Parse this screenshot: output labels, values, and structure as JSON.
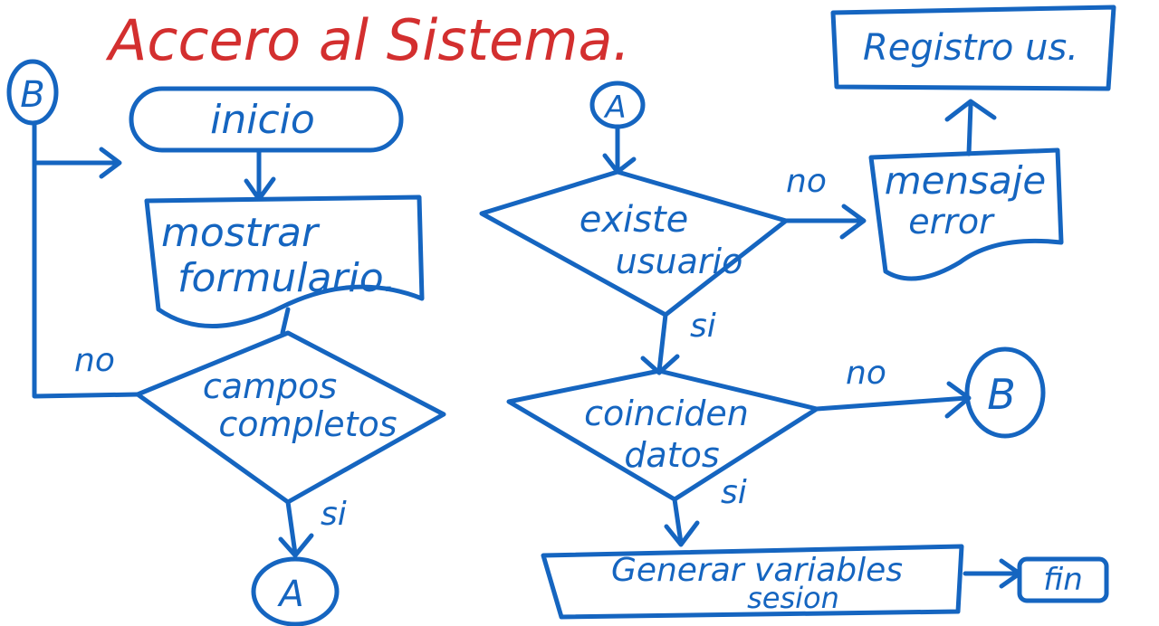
{
  "title": "Accero al Sistema.",
  "nodes": {
    "connector_b_left": "B",
    "inicio": "inicio",
    "mostrar_formulario": [
      "mostrar",
      "formulario."
    ],
    "campos_completos": [
      "campos",
      "completos"
    ],
    "connector_a_bottom": "A",
    "connector_a_top": "A",
    "existe_usuario": [
      "existe",
      "usuario"
    ],
    "mensaje_error": [
      "mensaje",
      "error"
    ],
    "registro_us": "Registro us.",
    "coinciden_datos": [
      "coinciden",
      "datos"
    ],
    "connector_b_right": "B",
    "generar_variables": [
      "Generar variables",
      "sesion"
    ],
    "fin": "fin"
  },
  "edge_labels": {
    "no_campos": "no",
    "si_campos": "si",
    "no_existe": "no",
    "si_existe": "si",
    "no_coinciden": "no",
    "si_coinciden": "si"
  },
  "colors": {
    "ink": "#1565c0",
    "title": "#d32f2f",
    "background": "#ffffff"
  }
}
